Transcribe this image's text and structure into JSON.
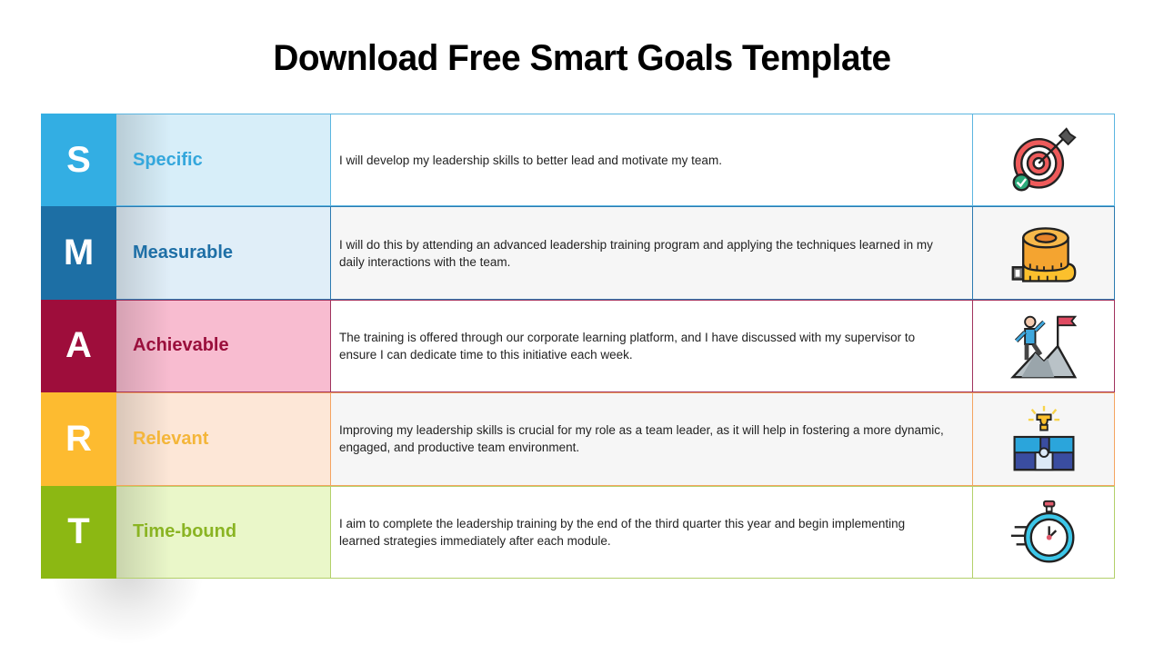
{
  "title": "Download Free Smart Goals Template",
  "rows": [
    {
      "letter": "S",
      "label": "Specific",
      "description": "I will develop my leadership skills to better lead and motivate my team.",
      "icon": "target-icon",
      "colors": {
        "letter_bg": "#33AEE3",
        "label_bg": "#D7EEF9",
        "label_text": "#34A7DC",
        "border": "#5BB5E0"
      }
    },
    {
      "letter": "M",
      "label": "Measurable",
      "description": "I will do this by attending an advanced leadership training program and applying the techniques learned in my daily interactions with the team.",
      "icon": "measuring-tape-icon",
      "colors": {
        "letter_bg": "#1D6FA5",
        "label_bg": "#E0EEF8",
        "label_text": "#1E6FA6",
        "border": "#2C7AB0"
      }
    },
    {
      "letter": "A",
      "label": "Achievable",
      "description": "The training is offered through our corporate learning platform, and I have discussed with my supervisor to ensure I can dedicate time to this initiative each week.",
      "icon": "mountain-climber-icon",
      "colors": {
        "letter_bg": "#9E0D3B",
        "label_bg": "#F8BCD0",
        "label_text": "#9A0F3C",
        "border": "#A0335E"
      }
    },
    {
      "letter": "R",
      "label": "Relevant",
      "description": "Improving my leadership skills is crucial for my role as a team leader, as it will help in fostering a more dynamic, engaged, and productive team environment.",
      "icon": "puzzle-icon",
      "colors": {
        "letter_bg": "#FDBB30",
        "label_bg": "#FDE7D7",
        "label_text": "#F4B63A",
        "border": "#F4A460"
      }
    },
    {
      "letter": "T",
      "label": "Time-bound",
      "description": "I aim to complete the leadership training by the end of the third quarter this year and begin implementing learned strategies immediately after each module.",
      "icon": "stopwatch-icon",
      "colors": {
        "letter_bg": "#8CB813",
        "label_bg": "#EAF7C9",
        "label_text": "#8AB423",
        "border": "#B3D06A"
      }
    }
  ]
}
